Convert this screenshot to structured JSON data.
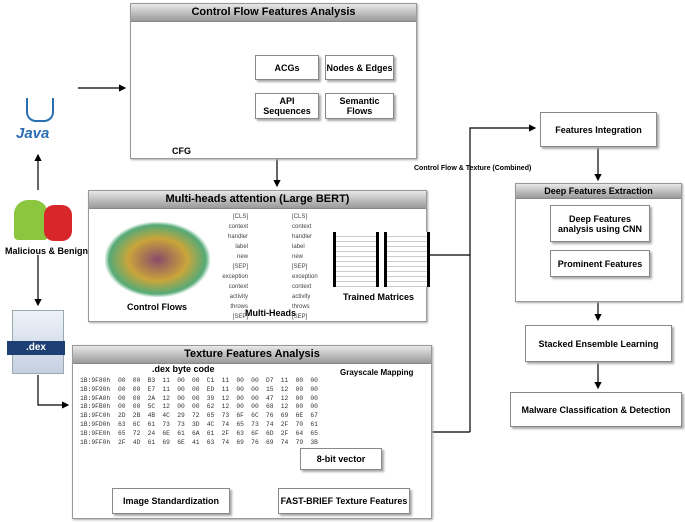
{
  "control_flow": {
    "title": "Control Flow Features Analysis",
    "cfg_label": "CFG",
    "features": [
      "ACGs",
      "Nodes & Edges",
      "API Sequences",
      "Semantic Flows"
    ]
  },
  "left": {
    "java_label": "Java",
    "android_label": "Malicious & Benign",
    "dex_label": ".dex"
  },
  "bert": {
    "title": "Multi-heads attention (Large BERT)",
    "control_flows": "Control Flows",
    "multi_heads": "Multi-Heads",
    "trained_matrices": "Trained Matrices",
    "tokens": [
      "[CLS]",
      "context",
      "handler",
      "label",
      "new",
      "[SEP]",
      "exception",
      "context",
      "activity",
      "throws",
      "[SEP]"
    ]
  },
  "texture": {
    "title": "Texture Features Analysis",
    "byte_code_title": ".dex byte code",
    "grayscale": "Grayscale Mapping",
    "vector": "8-bit vector",
    "standardization": "Image Standardization",
    "fast_brief": "FAST-BRIEF Texture Features",
    "hex_rows": [
      [
        "1B:9F80h",
        "00",
        "00",
        "B3",
        "11",
        "00",
        "00",
        "C1",
        "11",
        "00",
        "00",
        "D7",
        "11",
        "00",
        "00"
      ],
      [
        "1B:9F90h",
        "00",
        "00",
        "E7",
        "11",
        "00",
        "00",
        "ED",
        "11",
        "00",
        "00",
        "15",
        "12",
        "00",
        "00"
      ],
      [
        "1B:9FA0h",
        "00",
        "00",
        "2A",
        "12",
        "00",
        "00",
        "39",
        "12",
        "00",
        "00",
        "47",
        "12",
        "00",
        "00"
      ],
      [
        "1B:9FB0h",
        "00",
        "00",
        "5C",
        "12",
        "00",
        "00",
        "62",
        "12",
        "00",
        "00",
        "68",
        "12",
        "00",
        "00"
      ],
      [
        "1B:9FC0h",
        "2D",
        "2B",
        "4B",
        "4C",
        "29",
        "72",
        "65",
        "73",
        "6F",
        "6C",
        "76",
        "69",
        "6E",
        "67"
      ],
      [
        "1B:9FD0h",
        "63",
        "6C",
        "61",
        "73",
        "73",
        "3D",
        "4C",
        "74",
        "65",
        "73",
        "74",
        "2F",
        "70",
        "61"
      ],
      [
        "1B:9FE0h",
        "65",
        "72",
        "24",
        "6E",
        "61",
        "6A",
        "61",
        "2F",
        "63",
        "6F",
        "6D",
        "2F",
        "64",
        "65"
      ],
      [
        "1B:9FF0h",
        "2F",
        "4D",
        "61",
        "69",
        "6E",
        "41",
        "63",
        "74",
        "69",
        "76",
        "69",
        "74",
        "79",
        "3B"
      ]
    ]
  },
  "combined_label": "Control Flow & Texture (Combined)",
  "pipeline": {
    "integration": "Features Integration",
    "deep_title": "Deep Features Extraction",
    "cnn": "Deep Features analysis using CNN",
    "prominent": "Prominent Features",
    "ensemble": "Stacked Ensemble Learning",
    "classification": "Malware Classification & Detection"
  }
}
